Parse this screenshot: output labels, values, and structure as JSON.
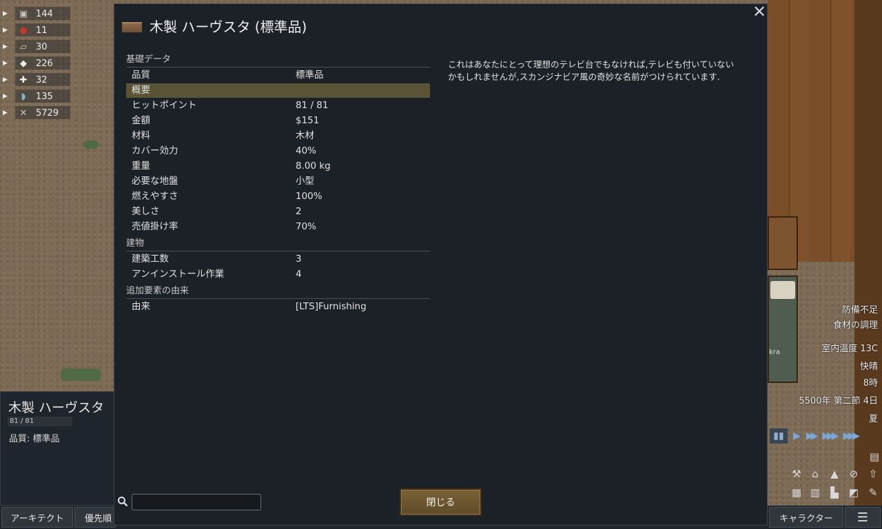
{
  "resources": [
    {
      "icon": "silver-icon",
      "value": "144"
    },
    {
      "icon": "berries-icon",
      "value": "11"
    },
    {
      "icon": "wood-icon",
      "value": "30"
    },
    {
      "icon": "cloth-icon",
      "value": "226"
    },
    {
      "icon": "medicine-icon",
      "value": "32"
    },
    {
      "icon": "herbal-icon",
      "value": "135"
    },
    {
      "icon": "steel-icon",
      "value": "5729"
    }
  ],
  "inspect": {
    "name": "木製 ハーヴスタ",
    "hp": "81 / 81",
    "quality": "品質: 標準品"
  },
  "dialog": {
    "title": "木製 ハーヴスタ (標準品)",
    "close_icon": "close-icon",
    "sections": {
      "basic": "基礎データ",
      "building": "建物",
      "mod": "追加要素の由来"
    },
    "basic_rows": [
      {
        "k": "品質",
        "v": "標準品"
      },
      {
        "k": "概要",
        "v": ""
      },
      {
        "k": "ヒットポイント",
        "v": "81 / 81"
      },
      {
        "k": "金額",
        "v": "$151"
      },
      {
        "k": "材料",
        "v": "木材"
      },
      {
        "k": "カバー効力",
        "v": "40%"
      },
      {
        "k": "重量",
        "v": "8.00 kg"
      },
      {
        "k": "必要な地盤",
        "v": "小型"
      },
      {
        "k": "燃えやすさ",
        "v": "100%"
      },
      {
        "k": "美しさ",
        "v": "2"
      },
      {
        "k": "売値掛け率",
        "v": "70%"
      }
    ],
    "building_rows": [
      {
        "k": "建築工数",
        "v": "3"
      },
      {
        "k": "アンインストール作業",
        "v": "4"
      }
    ],
    "mod_rows": [
      {
        "k": "由来",
        "v": "[LTS]Furnishing"
      }
    ],
    "description": "これはあなたにとって理想のテレビ台でもなければ,テレビも付いていないかもしれませんが,スカンジナビア風の奇妙な名前がつけられています.",
    "search_placeholder": "",
    "close_button": "閉じる"
  },
  "right_info": {
    "alert1": "防備不足",
    "alert2": "食材の調理",
    "temperature": "室内温度 13C",
    "mood": "快晴",
    "hour": "8時",
    "date": "5500年 第二節 4日",
    "season": "夏",
    "bed_label": "kra"
  },
  "bottom_tabs": {
    "architect": "アーキテクト",
    "priority": "優先順",
    "character": "キャラクター",
    "menu_icon": "menu-icon"
  },
  "colors": {
    "dialog_bg": "#1c2128",
    "highlight_row": "#5a5437",
    "close_button": "#6e5630",
    "speed_blue": "#7aa7d8"
  }
}
